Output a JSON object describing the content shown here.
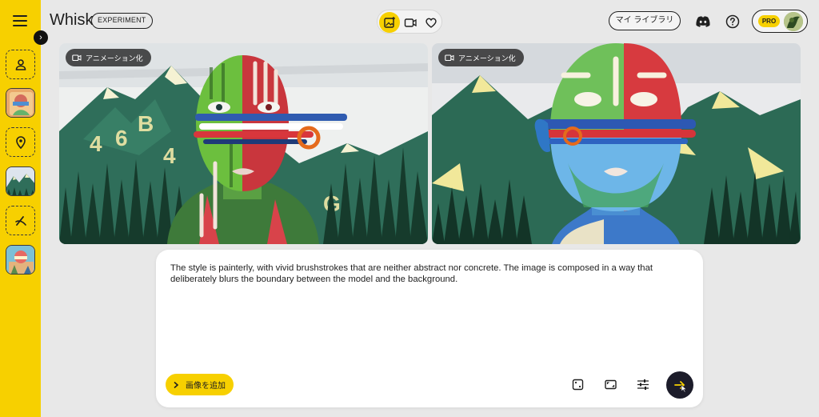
{
  "app": {
    "title": "Whisk",
    "badge": "EXPERIMENT"
  },
  "header": {
    "library_label": "マイ ライブラリ",
    "pro_label": "PRO",
    "modes": [
      "image-mode",
      "video-mode",
      "favorites"
    ],
    "icons": [
      "discord-icon",
      "help-icon"
    ]
  },
  "sidebar": {
    "slots": [
      {
        "kind": "subject",
        "icon": "person-icon",
        "filled": false
      },
      {
        "kind": "subject",
        "filled": true
      },
      {
        "kind": "scene",
        "icon": "location-pin-icon",
        "filled": false
      },
      {
        "kind": "scene",
        "filled": true
      },
      {
        "kind": "style",
        "icon": "brush-icon",
        "filled": false
      },
      {
        "kind": "style",
        "filled": true
      }
    ]
  },
  "images": [
    {
      "animate_label": "アニメーション化"
    },
    {
      "animate_label": "アニメーション化"
    }
  ],
  "prompt": {
    "text": "The style is painterly, with vivid brushstrokes that are neither abstract nor concrete. The image is composed in a way that deliberately blurs the boundary between the model and the background.",
    "add_image_label": "画像を追加"
  },
  "colors": {
    "accent": "#f7d000",
    "background": "#e8e8e8",
    "submit": "#1c1c2a"
  }
}
